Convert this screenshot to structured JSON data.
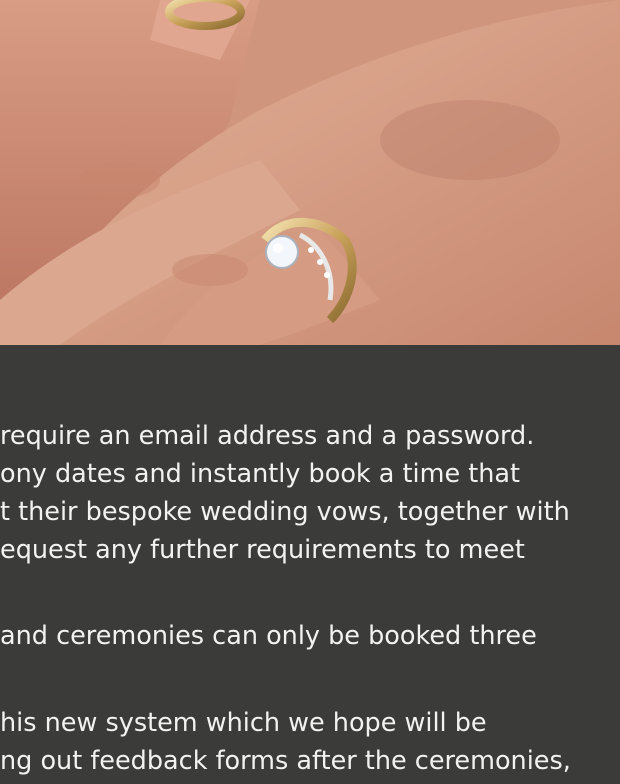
{
  "photo": {
    "subject": "hands-with-wedding-rings"
  },
  "article": {
    "para1": [
      "require an email address and a password.",
      "ony dates and instantly book a time that",
      "t their bespoke wedding vows, together with",
      "equest any further requirements to meet"
    ],
    "para2": [
      " and ceremonies can only be booked three"
    ],
    "para3": [
      "his new system which we hope will be",
      "ng out feedback forms after the ceremonies,"
    ]
  }
}
